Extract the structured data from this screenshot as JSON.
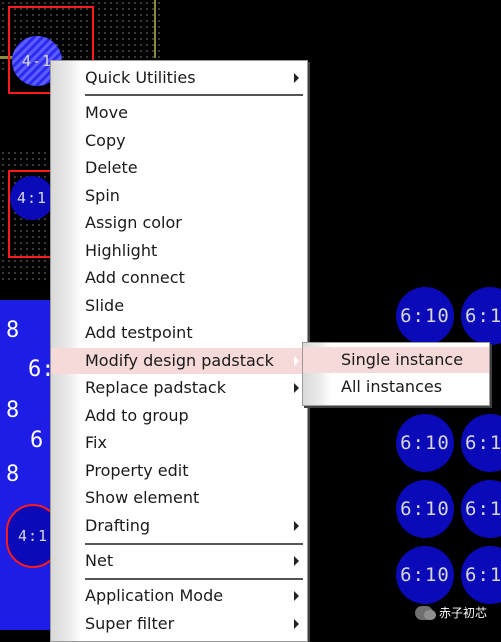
{
  "context_menu": {
    "items": [
      {
        "label": "Quick Utilities",
        "has_submenu": true
      },
      {
        "label": "Move"
      },
      {
        "label": "Copy"
      },
      {
        "label": "Delete"
      },
      {
        "label": "Spin"
      },
      {
        "label": "Assign color"
      },
      {
        "label": "Highlight"
      },
      {
        "label": "Add connect"
      },
      {
        "label": "Slide"
      },
      {
        "label": "Add testpoint"
      },
      {
        "label": "Modify design padstack",
        "has_submenu": true,
        "highlighted": true
      },
      {
        "label": "Replace padstack",
        "has_submenu": true
      },
      {
        "label": "Add to group"
      },
      {
        "label": "Fix"
      },
      {
        "label": "Property edit"
      },
      {
        "label": "Show element"
      },
      {
        "label": "Drafting",
        "has_submenu": true
      },
      {
        "label": "Net",
        "has_submenu": true
      },
      {
        "label": "Application Mode",
        "has_submenu": true
      },
      {
        "label": "Super filter",
        "has_submenu": true
      }
    ]
  },
  "submenu": {
    "items": [
      {
        "label": "Single instance",
        "highlighted": true
      },
      {
        "label": "All instances"
      }
    ]
  },
  "pcb": {
    "pad_labels": {
      "left_top": "4-1",
      "left_mid": "4:1",
      "left_bottom": "4:1",
      "right_grid": "6:10",
      "right_col2": "6:1",
      "partial_62": "6:",
      "big_8": "8",
      "big_6": "6"
    },
    "colors": {
      "background": "#000000",
      "pad": "#0a0ab8",
      "keepout": "#ff1a1a",
      "trace": "#8a8a3a",
      "menu_highlight": "#f6d9d9"
    }
  },
  "watermark": {
    "text": "赤子初芯"
  }
}
